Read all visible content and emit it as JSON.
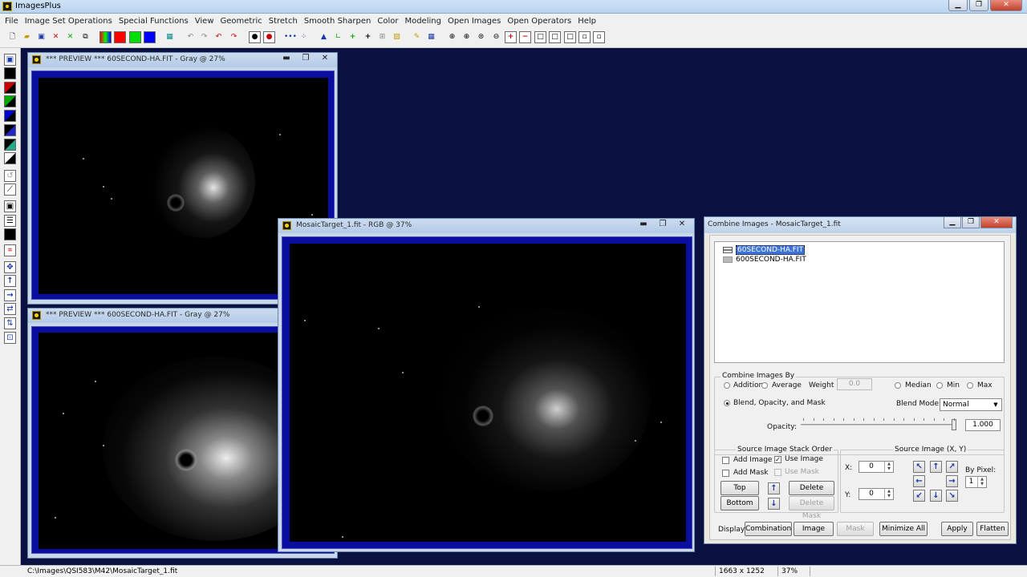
{
  "app": {
    "title": "ImagesPlus"
  },
  "menu": [
    "File",
    "Image Set Operations",
    "Special Functions",
    "View",
    "Geometric",
    "Stretch",
    "Smooth Sharpen",
    "Color",
    "Modeling",
    "Open Images",
    "Open Operators",
    "Help"
  ],
  "windows": {
    "preview1": {
      "title": "*** PREVIEW *** 60SECOND-HA.FIT - Gray @ 27%"
    },
    "preview2": {
      "title": "*** PREVIEW *** 600SECOND-HA.FIT - Gray @ 27%"
    },
    "mosaic": {
      "title": "MosaicTarget_1.fit - RGB @ 37%"
    }
  },
  "combine": {
    "title": "Combine Images - MosaicTarget_1.fit",
    "layers": [
      "60SECOND-HA.FIT",
      "600SECOND-HA.FIT"
    ],
    "combine_by_label": "Combine Images By",
    "addition": "Addition",
    "average": "Average",
    "weight_label": "Weight",
    "weight_value": "0.0",
    "median": "Median",
    "min": "Min",
    "max": "Max",
    "blend": "Blend, Opacity, and Mask",
    "blend_mode_label": "Blend Mode:",
    "blend_mode_value": "Normal",
    "opacity_label": "Opacity:",
    "opacity_value": "1.000",
    "opacity_level": 1.0,
    "stack_label": "Source Image Stack Order",
    "add_image": "Add Image",
    "use_image": "Use Image",
    "add_mask": "Add Mask",
    "use_mask": "Use Mask",
    "top": "Top",
    "bottom": "Bottom",
    "delete_image": "Delete Image",
    "delete_mask": "Delete Mask",
    "source_xy_label": "Source Image (X, Y)",
    "x_label": "X:",
    "x_value": "0",
    "y_label": "Y:",
    "y_value": "0",
    "by_pixel_label": "By Pixel:",
    "by_pixel_value": "1",
    "display_label": "Display:",
    "btn_combination": "Combination",
    "btn_image": "Image",
    "btn_mask": "Mask",
    "btn_minimize": "Minimize All",
    "btn_apply": "Apply",
    "btn_flatten": "Flatten"
  },
  "status": {
    "path": "C:\\Images\\QSI583\\M42\\MosaicTarget_1.fit",
    "dims": "1663 x 1252",
    "zoom": "37%"
  },
  "colors": {
    "desktop": "#0a1040",
    "frame": "#0a0ea0",
    "selection": "#3d74d8"
  }
}
